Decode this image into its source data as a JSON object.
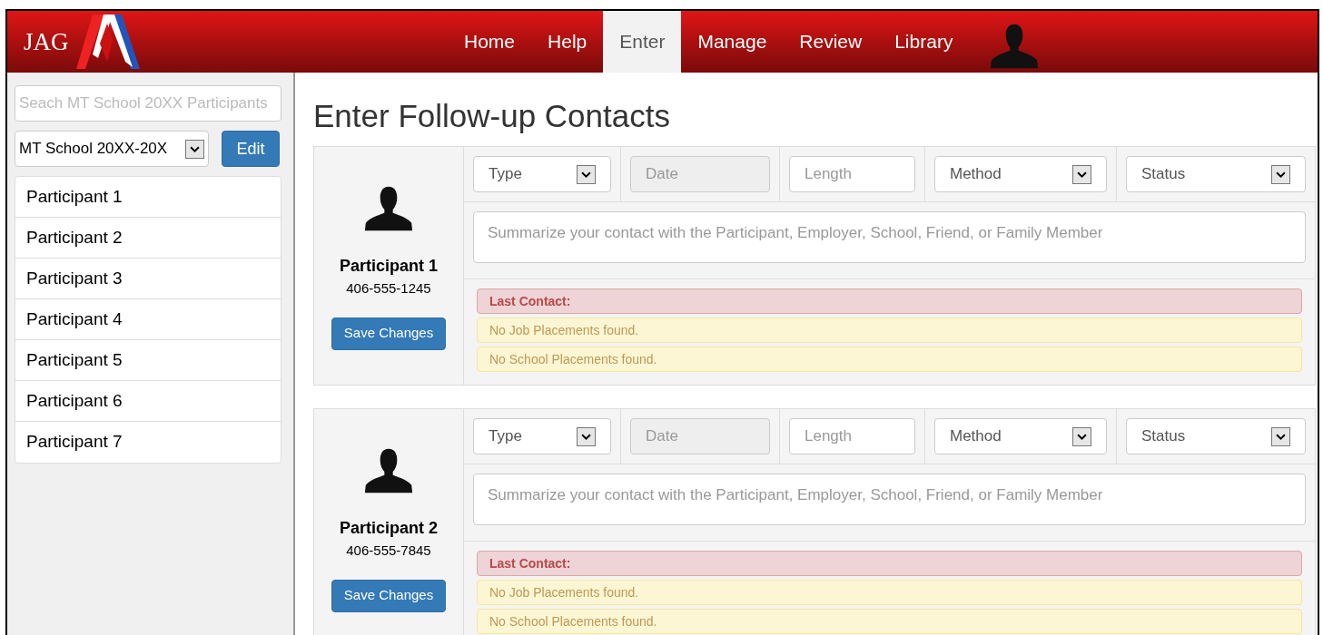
{
  "logo": {
    "text": "JAG"
  },
  "nav": [
    {
      "label": "Home",
      "selected": false
    },
    {
      "label": "Help",
      "selected": false
    },
    {
      "label": "Enter",
      "selected": true
    },
    {
      "label": "Manage",
      "selected": false
    },
    {
      "label": "Review",
      "selected": false
    },
    {
      "label": "Library",
      "selected": false
    }
  ],
  "sidebar": {
    "search": {
      "placeholder": "Seach MT School 20XX Participants"
    },
    "school_select": {
      "value": "MT School 20XX-20X"
    },
    "edit_button": "Edit",
    "items": [
      {
        "label": "Participant 1"
      },
      {
        "label": "Participant 2"
      },
      {
        "label": "Participant 3"
      },
      {
        "label": "Participant 4"
      },
      {
        "label": "Participant 5"
      },
      {
        "label": "Participant 6"
      },
      {
        "label": "Participant 7"
      }
    ]
  },
  "page_title": "Enter Follow-up Contacts",
  "contacts": [
    {
      "name": "Participant 1",
      "phone": "406-555-1245",
      "save_button": "Save Changes",
      "fields": [
        {
          "kind": "select",
          "placeholder": "Type",
          "disabled": false
        },
        {
          "kind": "input",
          "placeholder": "Date",
          "disabled": true
        },
        {
          "kind": "input",
          "placeholder": "Length",
          "disabled": false
        },
        {
          "kind": "select",
          "placeholder": "Method",
          "disabled": false
        },
        {
          "kind": "select",
          "placeholder": "Status",
          "disabled": false
        }
      ],
      "summary": {
        "placeholder": "Summarize your contact with the Participant, Employer, School, Friend, or Family Member"
      },
      "alerts": [
        {
          "kind": "danger",
          "text": "Last Contact:"
        },
        {
          "kind": "warning",
          "text": "No Job Placements found."
        },
        {
          "kind": "warning",
          "text": "No School Placements found."
        }
      ]
    },
    {
      "name": "Participant 2",
      "phone": "406-555-7845",
      "save_button": "Save Changes",
      "fields": [
        {
          "kind": "select",
          "placeholder": "Type",
          "disabled": false
        },
        {
          "kind": "input",
          "placeholder": "Date",
          "disabled": true
        },
        {
          "kind": "input",
          "placeholder": "Length",
          "disabled": false
        },
        {
          "kind": "select",
          "placeholder": "Method",
          "disabled": false
        },
        {
          "kind": "select",
          "placeholder": "Status",
          "disabled": false
        }
      ],
      "summary": {
        "placeholder": "Summarize your contact with the Participant, Employer, School, Friend, or Family Member"
      },
      "alerts": [
        {
          "kind": "danger",
          "text": "Last Contact:"
        },
        {
          "kind": "warning",
          "text": "No Job Placements found."
        },
        {
          "kind": "warning",
          "text": "No School Placements found."
        }
      ]
    }
  ]
}
